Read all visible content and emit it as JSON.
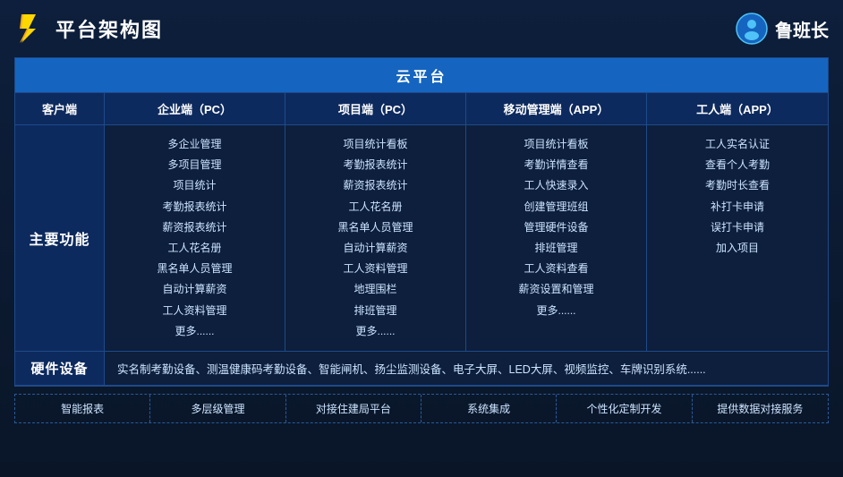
{
  "header": {
    "title": "平台架构图",
    "brand": "鲁班长"
  },
  "cloud_platform": {
    "label": "云平台"
  },
  "columns": {
    "client": "客户端",
    "enterprise_pc": "企业端（PC）",
    "project_pc": "项目端（PC）",
    "mobile_app": "移动管理端（APP）",
    "worker_app": "工人端（APP）"
  },
  "main_function_label": "主要功能",
  "enterprise_items": [
    "多企业管理",
    "多项目管理",
    "项目统计",
    "考勤报表统计",
    "薪资报表统计",
    "工人花名册",
    "黑名单人员管理",
    "自动计算薪资",
    "工人资料管理",
    "更多......"
  ],
  "project_items": [
    "项目统计看板",
    "考勤报表统计",
    "薪资报表统计",
    "工人花名册",
    "黑名单人员管理",
    "自动计算薪资",
    "工人资料管理",
    "地理围栏",
    "排班管理",
    "更多......"
  ],
  "mobile_items": [
    "项目统计看板",
    "考勤详情查看",
    "工人快速录入",
    "创建管理班组",
    "管理硬件设备",
    "排班管理",
    "工人资料查看",
    "薪资设置和管理",
    "更多......"
  ],
  "worker_items": [
    "工人实名认证",
    "查看个人考勤",
    "考勤时长查看",
    "补打卡申请",
    "误打卡申请",
    "加入项目"
  ],
  "hardware": {
    "label": "硬件设备",
    "content": "实名制考勤设备、测温健康码考勤设备、智能闸机、扬尘监测设备、电子大屏、LED大屏、视频监控、车牌识别系统......"
  },
  "features": [
    "智能报表",
    "多层级管理",
    "对接住建局平台",
    "系统集成",
    "个性化定制开发",
    "提供数据对接服务"
  ]
}
